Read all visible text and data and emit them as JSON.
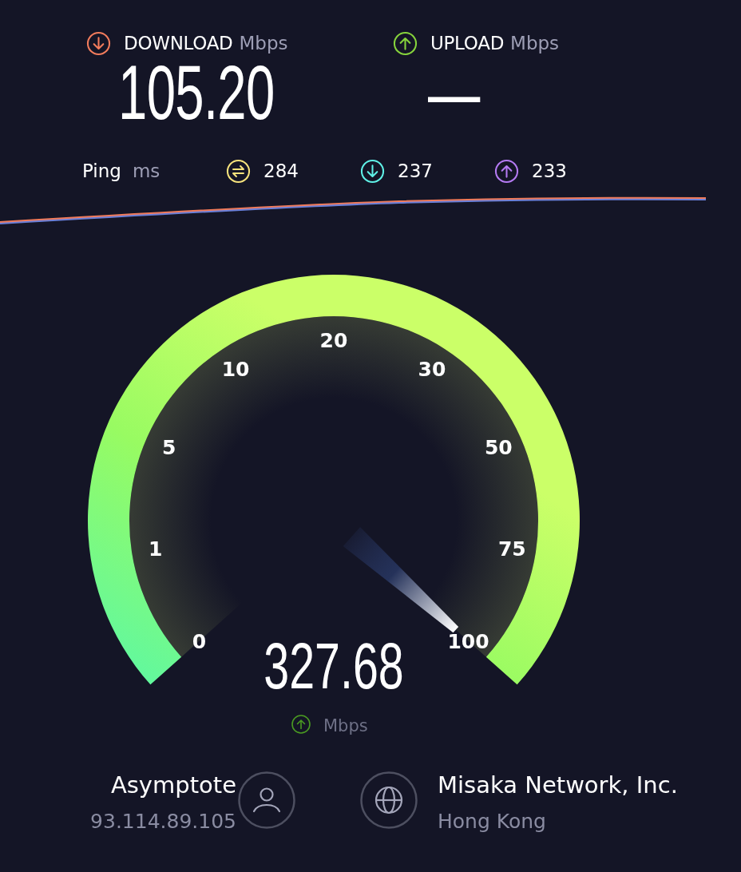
{
  "results": [
    {
      "kind": "download",
      "label": "DOWNLOAD",
      "unit": "Mbps",
      "value": "105.20"
    },
    {
      "kind": "upload",
      "label": "UPLOAD",
      "unit": "Mbps",
      "value": "—"
    }
  ],
  "ping": {
    "label": "Ping",
    "unit": "ms",
    "values": [
      {
        "kind": "jitter",
        "value": "284"
      },
      {
        "kind": "download",
        "value": "237"
      },
      {
        "kind": "upload",
        "value": "233"
      }
    ]
  },
  "gauge": {
    "labels": [
      "0",
      "1",
      "5",
      "10",
      "20",
      "30",
      "50",
      "75",
      "100"
    ],
    "reading": "327.68",
    "unit": "Mbps"
  },
  "client": {
    "name": "Asymptote",
    "ip": "93.114.89.105"
  },
  "server": {
    "name": "Misaka Network, Inc.",
    "location": "Hong Kong"
  }
}
